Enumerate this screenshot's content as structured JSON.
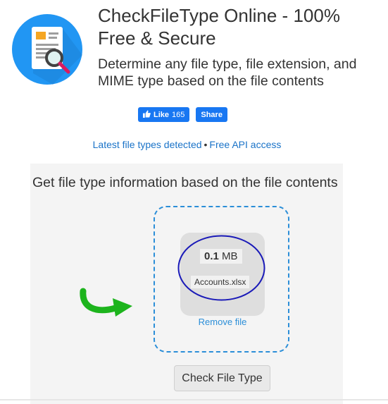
{
  "header": {
    "title": "CheckFileType Online - 100% Free & Secure",
    "subtitle": "Determine any file type, file extension, and MIME type based on the file contents"
  },
  "social": {
    "like_label": "Like",
    "like_count": "165",
    "share_label": "Share"
  },
  "links": {
    "latest": "Latest file types detected",
    "separator": "•",
    "api": "Free API access"
  },
  "upload": {
    "heading": "Get file type information based on the file contents",
    "file_size_value": "0.1",
    "file_size_unit": "MB",
    "file_name": "Accounts.xlsx",
    "remove_label": "Remove file",
    "check_button": "Check File Type"
  },
  "colors": {
    "facebook_blue": "#1877f2",
    "link_blue": "#1a73c8",
    "dropzone_border": "#2b8ed8",
    "annotation_ellipse": "#1a1ab8",
    "arrow_green": "#1db41d",
    "logo_circle": "#2196f3"
  },
  "icons": {
    "logo": "document-magnifier-icon",
    "like": "thumbs-up-icon",
    "arrow": "curved-arrow-right-icon"
  }
}
